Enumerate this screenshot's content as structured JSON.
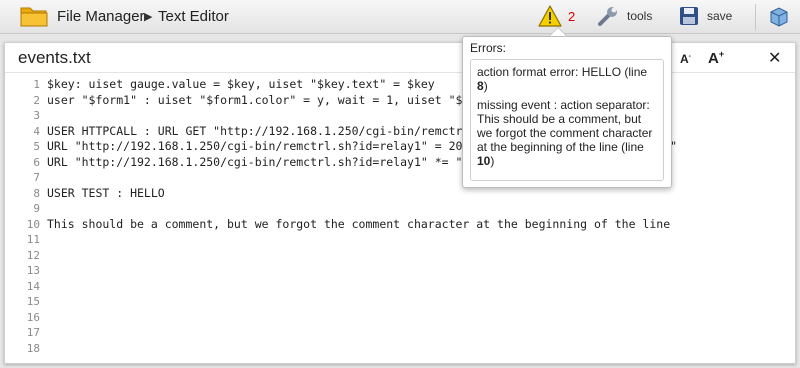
{
  "toolbar": {
    "folder_icon": "folder-icon",
    "breadcrumb": [
      "File Manager",
      "Text Editor"
    ],
    "breadcrumb_separator": "▶",
    "error_count": "2",
    "tools_label": "tools",
    "save_label": "save",
    "warning_icon": "warning-icon",
    "tools_icon": "wrench-icon",
    "save_icon": "floppy-disk-icon",
    "cube_icon": "cube-icon",
    "accent_error_color": "#d40000"
  },
  "editor": {
    "file_name": "events.txt",
    "font_decrease": "A-",
    "font_increase": "A+",
    "close": "✕",
    "lines": [
      {
        "n": "1",
        "text": "$key: uiset gauge.value = $key, uiset \"$key.text\" = $key"
      },
      {
        "n": "2",
        "text": "user \"$form1\" : uiset \"$form1.color\" = y, wait = 1, uiset \"$f"
      },
      {
        "n": "3",
        "text": ""
      },
      {
        "n": "4",
        "text": "USER HTTPCALL : URL GET \"http://192.168.1.250/cgi-bin/remctrl"
      },
      {
        "n": "5",
        "text": "URL \"http://192.168.1.250/cgi-bin/remctrl.sh?id=relay1\" = 200                     d 200 ok\""
      },
      {
        "n": "6",
        "text": "URL \"http://192.168.1.250/cgi-bin/remctrl.sh?id=relay1\" *= \"a                     ated\""
      },
      {
        "n": "7",
        "text": ""
      },
      {
        "n": "8",
        "text": "USER TEST : HELLO"
      },
      {
        "n": "9",
        "text": ""
      },
      {
        "n": "10",
        "text": "This should be a comment, but we forgot the comment character at the beginning of the line"
      },
      {
        "n": "11",
        "text": ""
      },
      {
        "n": "12",
        "text": ""
      },
      {
        "n": "13",
        "text": ""
      },
      {
        "n": "14",
        "text": ""
      },
      {
        "n": "15",
        "text": ""
      },
      {
        "n": "16",
        "text": ""
      },
      {
        "n": "17",
        "text": ""
      },
      {
        "n": "18",
        "text": ""
      }
    ]
  },
  "errors_popup": {
    "title": "Errors:",
    "items": [
      {
        "text": "action format error: HELLO (line ",
        "line": "8",
        "suffix": ")"
      },
      {
        "text": "missing event : action separator: This should be a comment, but we forgot the comment character at the beginning of the line (line ",
        "line": "10",
        "suffix": ")"
      }
    ]
  }
}
